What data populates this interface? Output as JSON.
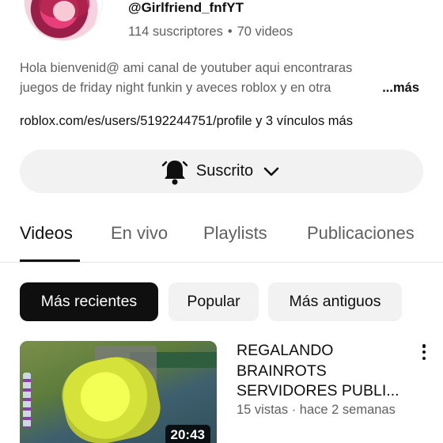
{
  "channel": {
    "handle": "@Girlfriend_fnfYT",
    "subscribers": "114 suscriptores",
    "separator": "•",
    "videos": "70 videos",
    "description_line1": "Hola bienvenid@ ami canal de youtuber aqui encontraras",
    "description_line2": "juegos de friday night funkin y aveces roblox y en otra",
    "more_label": "...más",
    "link_main": "roblox.com/es/users/5192244751/profile",
    "link_suffix": " y 3 vínculos más"
  },
  "subscribe": {
    "label": "Suscrito",
    "icon": "bell-icon",
    "dropdown_icon": "chevron-down-icon"
  },
  "tabs": [
    {
      "label": "Videos",
      "active": true
    },
    {
      "label": "En vivo",
      "active": false
    },
    {
      "label": "Playlists",
      "active": false
    },
    {
      "label": "Publicaciones",
      "active": false
    }
  ],
  "chips": [
    {
      "label": "Más recientes",
      "active": true
    },
    {
      "label": "Popular",
      "active": false
    },
    {
      "label": "Más antiguos",
      "active": false
    }
  ],
  "video": {
    "title_line1": "REGALANDO",
    "title_line2": "BRAINROTS",
    "title_line3": "SERVIDORES PUBLI...",
    "meta": "15 vistas · hace 2 semanas",
    "duration": "20:43"
  },
  "colors": {
    "text_primary": "#0f0f0f",
    "text_secondary": "#606060",
    "chip_bg": "#f2f2f2",
    "chip_active_bg": "#0f0f0f"
  }
}
